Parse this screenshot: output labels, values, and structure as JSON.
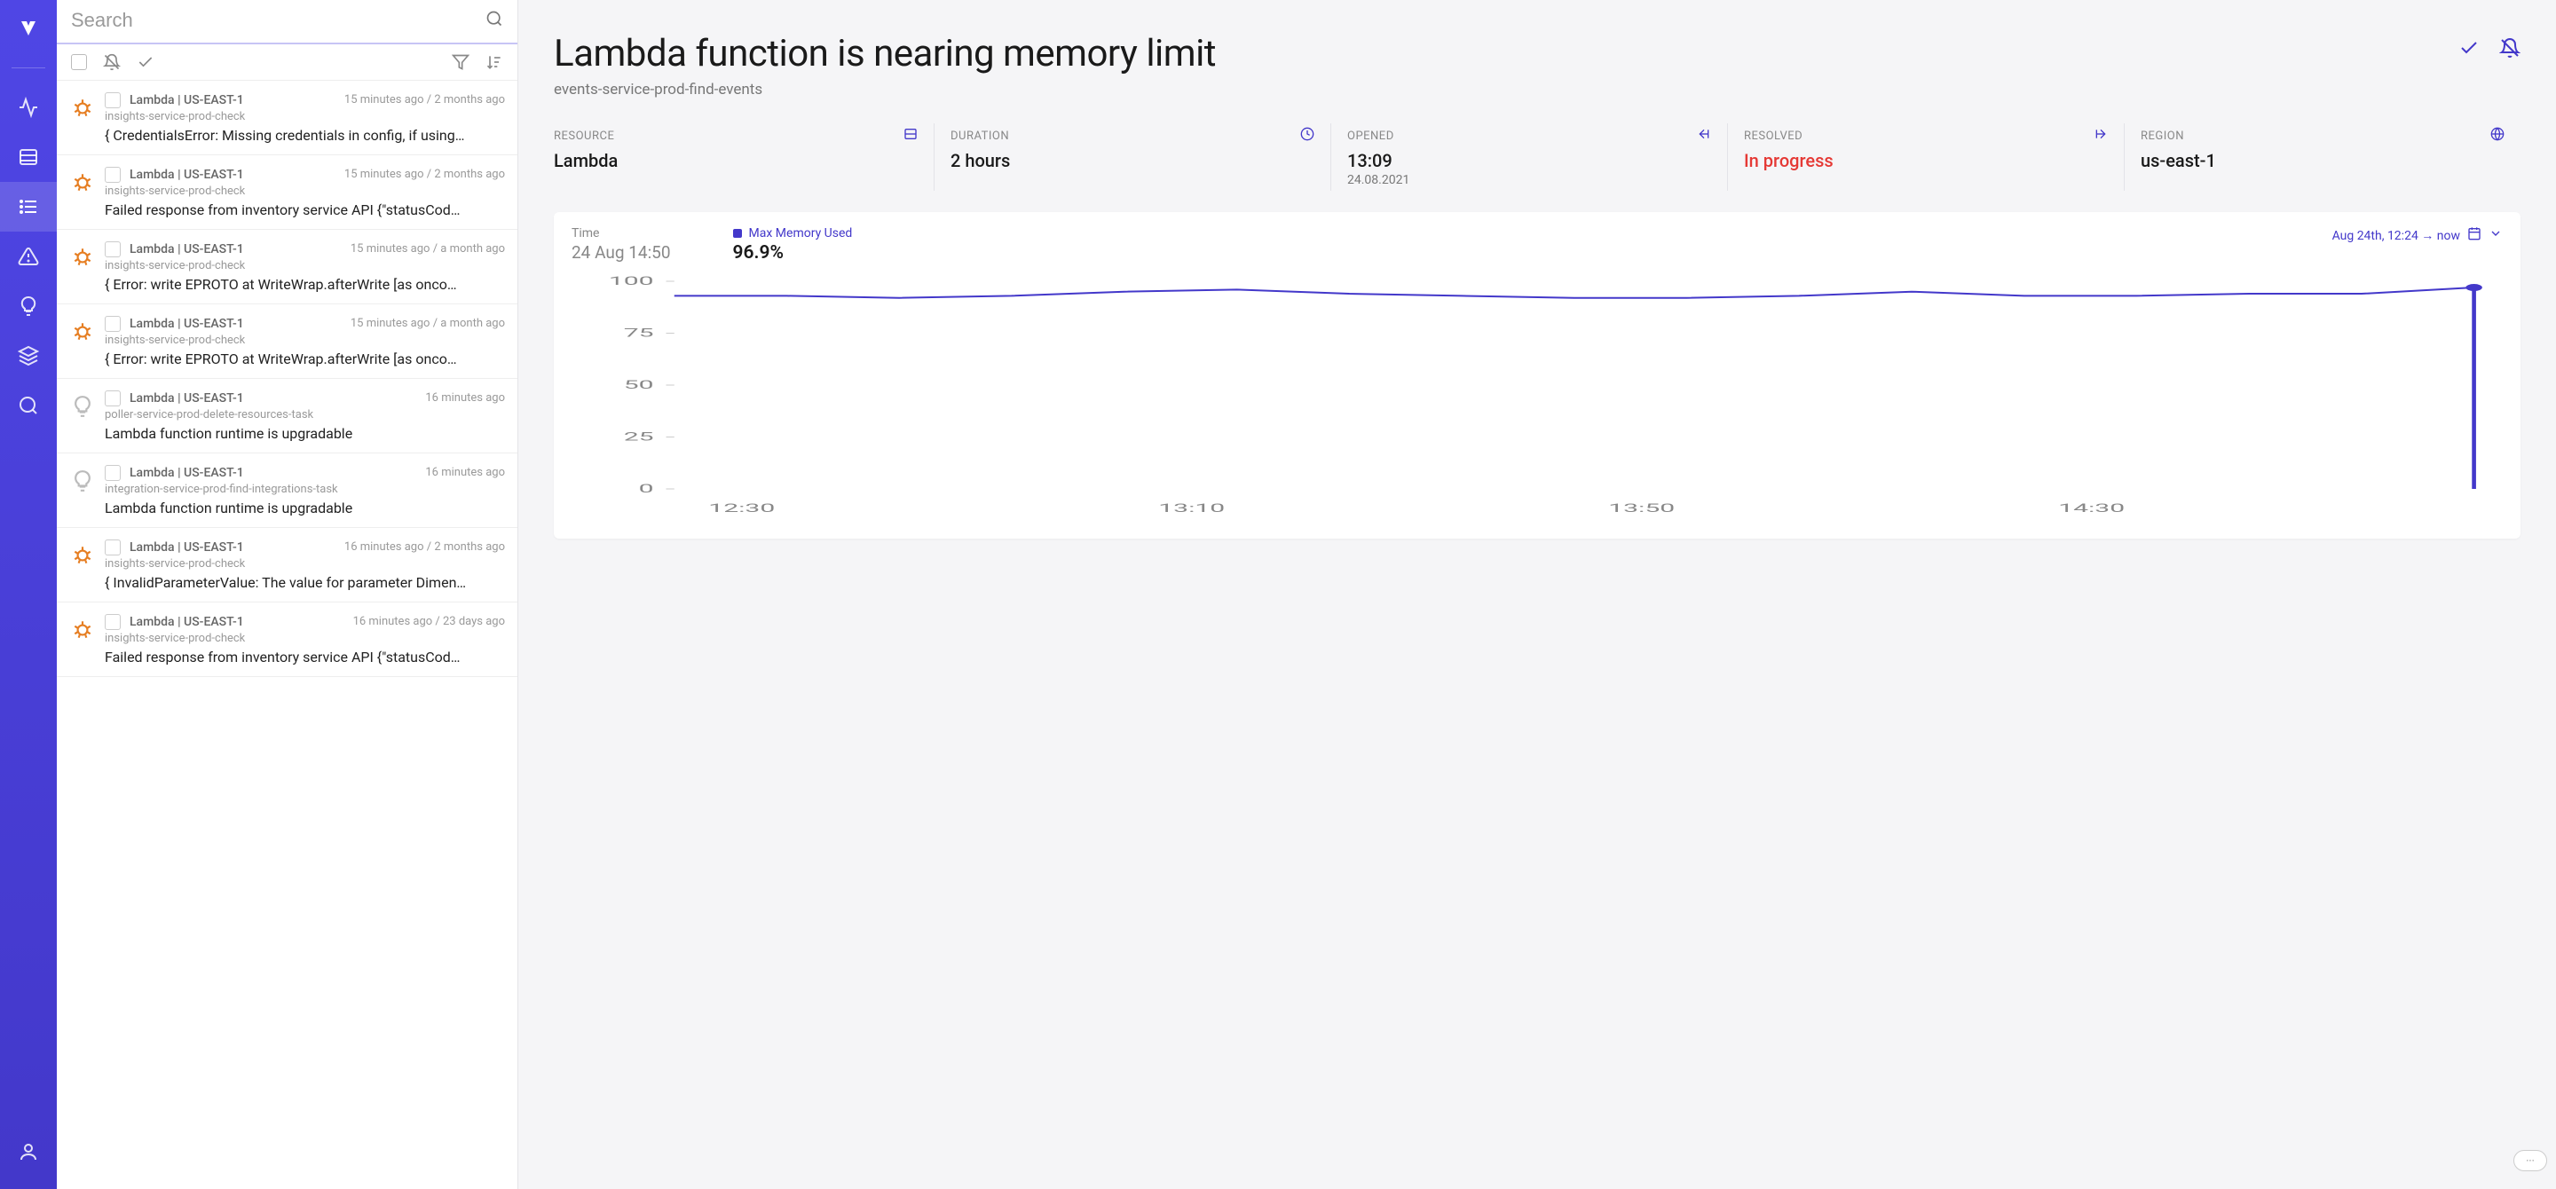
{
  "search": {
    "placeholder": "Search"
  },
  "list": {
    "items": [
      {
        "icon": "bug",
        "meta": "Lambda | US-EAST-1",
        "time": "15 minutes ago / 2 months ago",
        "sub": "insights-service-prod-check",
        "title": "{ CredentialsError: Missing credentials in config, if using…"
      },
      {
        "icon": "bug",
        "meta": "Lambda | US-EAST-1",
        "time": "15 minutes ago / 2 months ago",
        "sub": "insights-service-prod-check",
        "title": "Failed response from inventory service API {\"statusCod…"
      },
      {
        "icon": "bug",
        "meta": "Lambda | US-EAST-1",
        "time": "15 minutes ago / a month ago",
        "sub": "insights-service-prod-check",
        "title": "{ Error: write EPROTO at WriteWrap.afterWrite [as onco…"
      },
      {
        "icon": "bug",
        "meta": "Lambda | US-EAST-1",
        "time": "15 minutes ago / a month ago",
        "sub": "insights-service-prod-check",
        "title": "{ Error: write EPROTO at WriteWrap.afterWrite [as onco…"
      },
      {
        "icon": "bulb",
        "meta": "Lambda | US-EAST-1",
        "time": "16 minutes ago",
        "sub": "poller-service-prod-delete-resources-task",
        "title": "Lambda function runtime is upgradable"
      },
      {
        "icon": "bulb",
        "meta": "Lambda | US-EAST-1",
        "time": "16 minutes ago",
        "sub": "integration-service-prod-find-integrations-task",
        "title": "Lambda function runtime is upgradable"
      },
      {
        "icon": "bug",
        "meta": "Lambda | US-EAST-1",
        "time": "16 minutes ago / 2 months ago",
        "sub": "insights-service-prod-check",
        "title": "{ InvalidParameterValue: The value for parameter Dimen…"
      },
      {
        "icon": "bug",
        "meta": "Lambda | US-EAST-1",
        "time": "16 minutes ago / 23 days ago",
        "sub": "insights-service-prod-check",
        "title": "Failed response from inventory service API {\"statusCod…"
      }
    ]
  },
  "detail": {
    "title": "Lambda function is nearing memory limit",
    "subtitle": "events-service-prod-find-events",
    "info": {
      "resource": {
        "label": "RESOURCE",
        "value": "Lambda"
      },
      "duration": {
        "label": "DURATION",
        "value": "2 hours"
      },
      "opened": {
        "label": "OPENED",
        "value": "13:09",
        "value2": "24.08.2021"
      },
      "resolved": {
        "label": "RESOLVED",
        "value": "In progress"
      },
      "region": {
        "label": "REGION",
        "value": "us-east-1"
      }
    },
    "chart": {
      "time_label": "Time",
      "time_value": "24 Aug 14:50",
      "legend": "Max Memory Used",
      "big_value": "96.9%",
      "range": "Aug 24th, 12:24 → now"
    }
  },
  "chart_data": {
    "type": "line",
    "title": "Max Memory Used",
    "xlabel": "",
    "ylabel": "",
    "ylim": [
      0,
      100
    ],
    "y_ticks": [
      0,
      25,
      50,
      75,
      100
    ],
    "x_ticks": [
      "12:30",
      "13:10",
      "13:50",
      "14:30"
    ],
    "series": [
      {
        "name": "Max Memory Used",
        "color": "#4338ca",
        "x": [
          "12:24",
          "12:30",
          "12:40",
          "12:50",
          "13:00",
          "13:10",
          "13:20",
          "13:30",
          "13:40",
          "13:50",
          "14:00",
          "14:10",
          "14:20",
          "14:30",
          "14:40",
          "14:50",
          "14:51"
        ],
        "values": [
          93,
          93,
          92,
          93,
          95,
          96,
          94,
          93,
          92,
          92,
          93,
          95,
          93,
          93,
          94,
          94,
          97
        ]
      }
    ],
    "annotations": [
      {
        "x": "14:50",
        "y": 96.9,
        "label": "96.9%"
      }
    ]
  }
}
